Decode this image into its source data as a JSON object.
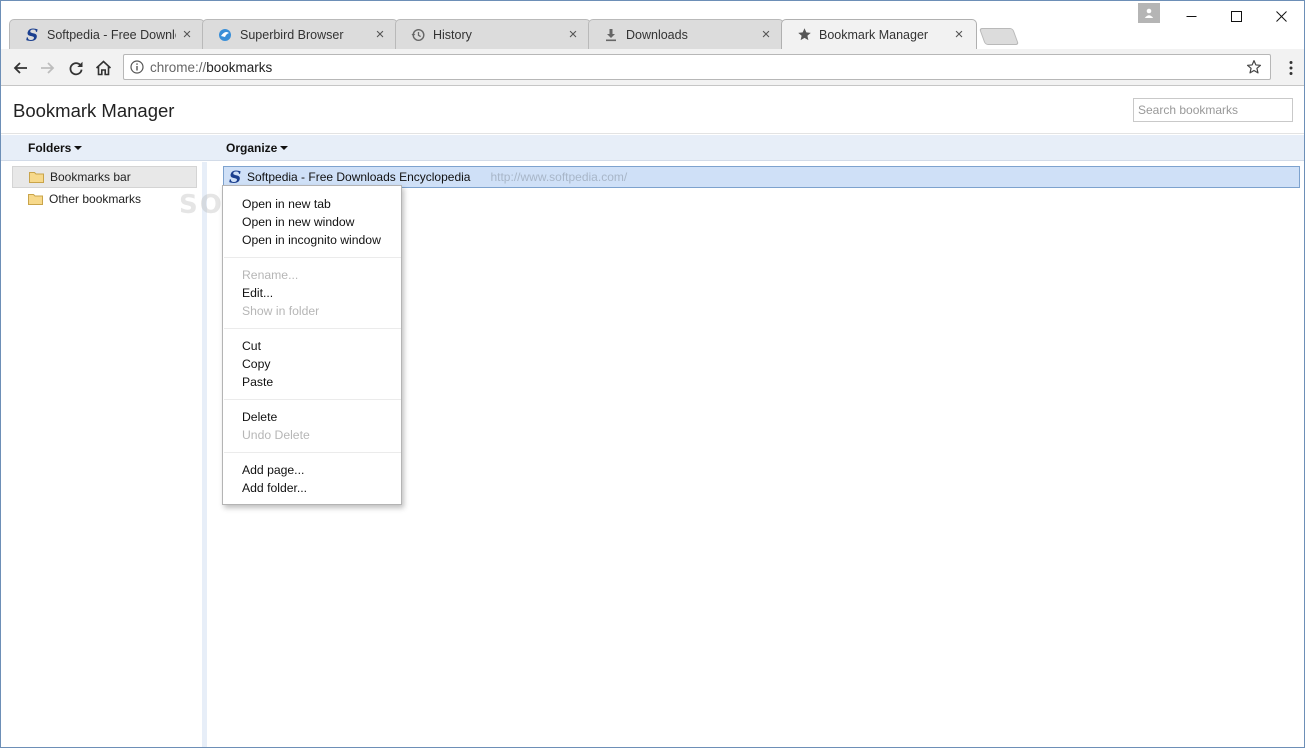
{
  "tabs": [
    {
      "title": "Softpedia - Free Downloads Encyclopedia",
      "icon": "softpedia-icon"
    },
    {
      "title": "Superbird Browser",
      "icon": "superbird-icon"
    },
    {
      "title": "History",
      "icon": "history-icon"
    },
    {
      "title": "Downloads",
      "icon": "download-icon"
    },
    {
      "title": "Bookmark Manager",
      "icon": "star-icon",
      "active": true
    }
  ],
  "omnibox": {
    "scheme": "chrome://",
    "host": "bookmarks"
  },
  "page": {
    "title": "Bookmark Manager",
    "search_placeholder": "Search bookmarks"
  },
  "menubar": {
    "folders": "Folders",
    "organize": "Organize"
  },
  "folders": [
    {
      "label": "Bookmarks bar",
      "selected": true
    },
    {
      "label": "Other bookmarks",
      "selected": false
    }
  ],
  "bookmarks": [
    {
      "title": "Softpedia - Free Downloads Encyclopedia",
      "url": "http://www.softpedia.com/"
    }
  ],
  "context_menu": {
    "groups": [
      [
        {
          "label": "Open in new tab",
          "enabled": true
        },
        {
          "label": "Open in new window",
          "enabled": true
        },
        {
          "label": "Open in incognito window",
          "enabled": true
        }
      ],
      [
        {
          "label": "Rename...",
          "enabled": false
        },
        {
          "label": "Edit...",
          "enabled": true
        },
        {
          "label": "Show in folder",
          "enabled": false
        }
      ],
      [
        {
          "label": "Cut",
          "enabled": true
        },
        {
          "label": "Copy",
          "enabled": true
        },
        {
          "label": "Paste",
          "enabled": true
        }
      ],
      [
        {
          "label": "Delete",
          "enabled": true
        },
        {
          "label": "Undo Delete",
          "enabled": false
        }
      ],
      [
        {
          "label": "Add page...",
          "enabled": true
        },
        {
          "label": "Add folder...",
          "enabled": true
        }
      ]
    ]
  },
  "watermark": "SOFTPEDIA",
  "colors": {
    "selection": "#cfe0f7",
    "selection_border": "#7da2ce",
    "menubar_bg": "#e7eef8",
    "softpedia_blue": "#1b3f8f"
  }
}
